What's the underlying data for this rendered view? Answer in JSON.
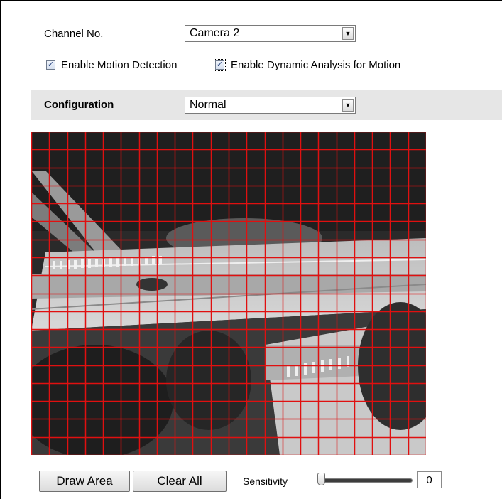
{
  "channel": {
    "label": "Channel No.",
    "selected": "Camera 2"
  },
  "checkboxes": {
    "motion_detection": {
      "label": "Enable Motion Detection",
      "checked": true
    },
    "dynamic_analysis": {
      "label": "Enable Dynamic Analysis for Motion",
      "checked": true
    }
  },
  "configuration": {
    "label": "Configuration",
    "selected": "Normal"
  },
  "video": {
    "grid_columns": 22,
    "grid_rows": 18,
    "grid_color": "#e01010"
  },
  "toolbar": {
    "draw_area_label": "Draw Area",
    "clear_all_label": "Clear All",
    "sensitivity_label": "Sensitivity",
    "sensitivity_value": "0",
    "sensitivity_fraction": 0
  },
  "icons": {
    "dropdown": "chevron-down-icon",
    "check": "checkmark-icon"
  },
  "colors": {
    "config_bar": "#e6e6e6",
    "grid": "#e01010"
  }
}
